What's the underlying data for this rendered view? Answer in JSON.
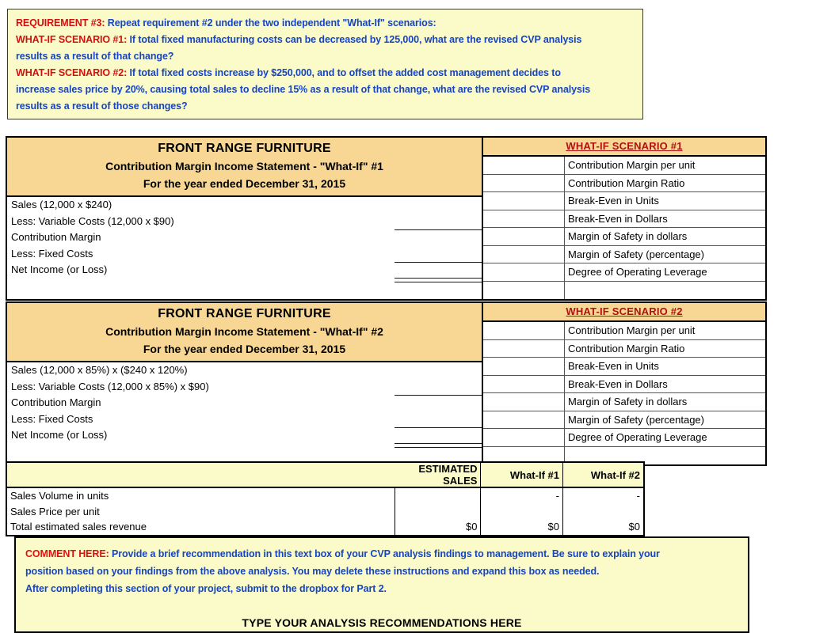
{
  "requirement_box": {
    "lines": [
      {
        "lead": "REQUIREMENT #3:",
        "text": "  Repeat requirement #2 under the two independent \"What-If\" scenarios:"
      },
      {
        "lead": "WHAT-IF SCENARIO #1:",
        "text": "  If total fixed manufacturing costs can be decreased by 125,000, what are the revised CVP analysis"
      },
      {
        "lead": "",
        "text": "results as a result of that change?"
      },
      {
        "lead": "WHAT-IF SCENARIO #2:",
        "text": " If total fixed costs increase by $250,000, and to offset the added cost management decides to"
      },
      {
        "lead": "",
        "text": "increase sales price by 20%, causing total sales to decline 15% as a result of that change, what are the revised CVP analysis"
      },
      {
        "lead": "",
        "text": "results as a result of those changes?"
      }
    ]
  },
  "statement1": {
    "title_line1": "FRONT RANGE FURNITURE",
    "title_line2": "Contribution Margin Income Statement - \"What-If\" #1",
    "title_line3": "For the year ended December 31, 2015",
    "rows": [
      "Sales (12,000 x $240)",
      "Less:  Variable Costs  (12,000 x $90)",
      "Contribution Margin",
      "Less:  Fixed Costs",
      "Net Income (or Loss)"
    ],
    "scenario_header": "WHAT-IF SCENARIO #1",
    "metrics": [
      "Contribution Margin per unit",
      "Contribution Margin Ratio",
      "Break-Even in Units",
      "Break-Even in Dollars",
      "Margin of Safety in dollars",
      "Margin of Safety (percentage)",
      "Degree of Operating Leverage"
    ],
    "metric_values": [
      "",
      "",
      "",
      "",
      "",
      "",
      ""
    ]
  },
  "statement2": {
    "title_line1": "FRONT RANGE FURNITURE",
    "title_line2": "Contribution Margin Income Statement - \"What-If\" #2",
    "title_line3": "For the year ended December 31, 2015",
    "rows": [
      "Sales (12,000 x 85%) x ($240 x 120%)",
      "Less:  Variable Costs (12,000 x 85%) x $90)",
      "Contribution Margin",
      "Less:  Fixed Costs",
      "Net Income (or Loss)"
    ],
    "scenario_header": "WHAT-IF SCENARIO #2",
    "metrics": [
      "Contribution Margin per unit",
      "Contribution Margin Ratio",
      "Break-Even in Units",
      "Break-Even in Dollars",
      "Margin of Safety in dollars",
      "Margin of Safety (percentage)",
      "Degree of Operating Leverage"
    ],
    "metric_values": [
      "",
      "",
      "",
      "",
      "",
      "",
      ""
    ]
  },
  "estimated_sales_table": {
    "headers": [
      "",
      "ESTIMATED SALES",
      "What-If #1",
      "What-If #2"
    ],
    "rows": [
      {
        "label": "Sales Volume in units",
        "estimated": "",
        "what_if_1": "-",
        "what_if_2": "-"
      },
      {
        "label": "Sales Price per unit",
        "estimated": "",
        "what_if_1": "",
        "what_if_2": ""
      },
      {
        "label": "Total estimated sales revenue",
        "estimated": "$0",
        "what_if_1": "$0",
        "what_if_2": "$0"
      }
    ]
  },
  "comment_box": {
    "lines": [
      {
        "lead": "COMMENT HERE:",
        "text": " Provide a brief recommendation in this text box of your CVP analysis findings to management.   Be sure to explain your"
      },
      {
        "lead": "",
        "text": "position based on your findings from the above analysis.  You may delete these instructions and expand this box as needed."
      },
      {
        "lead": "",
        "text": "After completing this section of your project, submit to the dropbox for Part 2."
      }
    ],
    "type_here": "TYPE YOUR ANALYSIS RECOMMENDATIONS HERE"
  },
  "colors": {
    "header_tan": "#F7D793",
    "note_yellow": "#FBFBC9",
    "instruction_blue": "#1544C4",
    "instruction_red": "#D01010",
    "scenario_red": "#B01010"
  }
}
